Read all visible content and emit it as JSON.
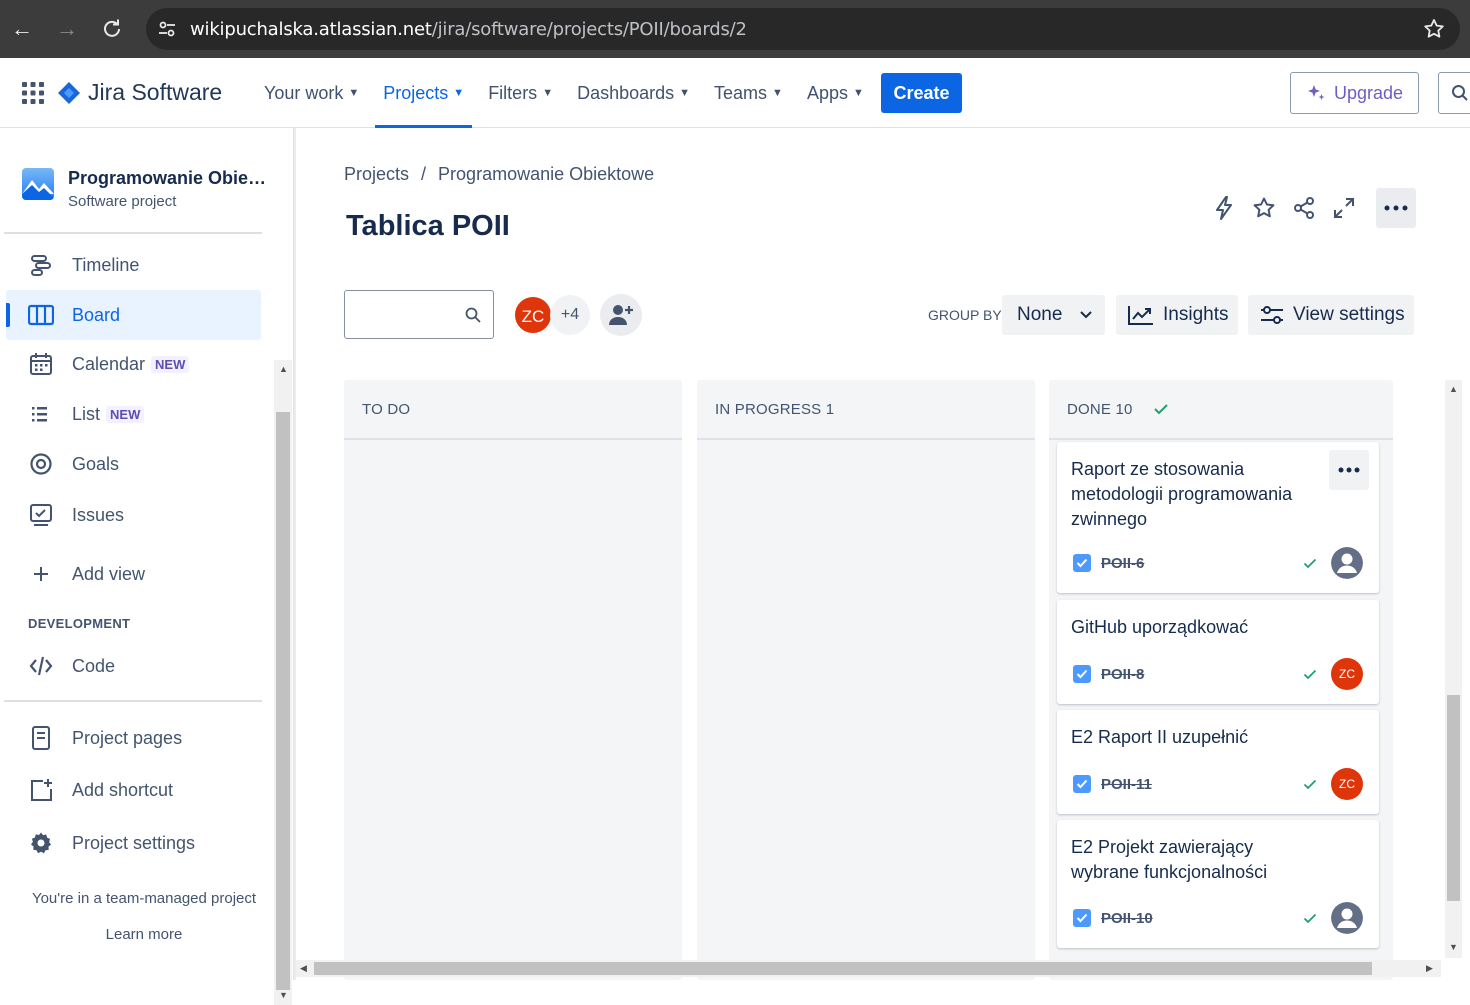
{
  "browser": {
    "url_host": "wikipuchalska.atlassian.net",
    "url_path": "/jira/software/projects/POII/boards/2"
  },
  "topnav": {
    "product": "Jira Software",
    "items": [
      {
        "label": "Your work"
      },
      {
        "label": "Projects",
        "active": true
      },
      {
        "label": "Filters"
      },
      {
        "label": "Dashboards"
      },
      {
        "label": "Teams"
      },
      {
        "label": "Apps"
      }
    ],
    "create_label": "Create",
    "upgrade_label": "Upgrade"
  },
  "sidebar": {
    "project_name": "Programowanie Obiekt...",
    "project_type": "Software project",
    "items": [
      {
        "label": "Timeline",
        "icon": "timeline-icon"
      },
      {
        "label": "Board",
        "icon": "board-icon",
        "active": true
      },
      {
        "label": "Calendar",
        "icon": "calendar-icon",
        "badge": "NEW"
      },
      {
        "label": "List",
        "icon": "list-icon",
        "badge": "NEW"
      },
      {
        "label": "Goals",
        "icon": "goals-icon"
      },
      {
        "label": "Issues",
        "icon": "issues-icon"
      },
      {
        "label": "Add view",
        "icon": "plus-icon"
      }
    ],
    "section_label": "DEVELOPMENT",
    "dev_items": [
      {
        "label": "Code",
        "icon": "code-icon"
      }
    ],
    "bottom_items": [
      {
        "label": "Project pages",
        "icon": "page-icon"
      },
      {
        "label": "Add shortcut",
        "icon": "add-shortcut-icon"
      },
      {
        "label": "Project settings",
        "icon": "gear-icon"
      }
    ],
    "footer_text": "You're in a team-managed project",
    "learn_more": "Learn more"
  },
  "main": {
    "breadcrumb": [
      "Projects",
      "Programowanie Obiektowe"
    ],
    "title": "Tablica POII",
    "avatar_initials": "ZC",
    "avatar_more": "+4",
    "groupby_label": "GROUP BY",
    "groupby_value": "None",
    "insights_label": "Insights",
    "view_settings_label": "View settings",
    "columns": [
      {
        "label": "TO DO"
      },
      {
        "label": "IN PROGRESS 1"
      },
      {
        "label": "DONE 10"
      }
    ],
    "cards": [
      {
        "title": "Raport ze stosowania metodologii programowania zwinnego",
        "key": "POII-6",
        "assignee": "unassigned"
      },
      {
        "title": "GitHub uporządkować",
        "key": "POII-8",
        "assignee": "ZC"
      },
      {
        "title": "E2 Raport II uzupełnić",
        "key": "POII-11",
        "assignee": "ZC"
      },
      {
        "title": "E2 Projekt zawierający wybrane funkcjonalności",
        "key": "POII-10",
        "assignee": "unassigned"
      }
    ]
  },
  "colors": {
    "accent": "#0c66e4",
    "avatar_zc": "#de350b",
    "done_check": "#22a06b",
    "upgrade": "#6e5dc6"
  }
}
